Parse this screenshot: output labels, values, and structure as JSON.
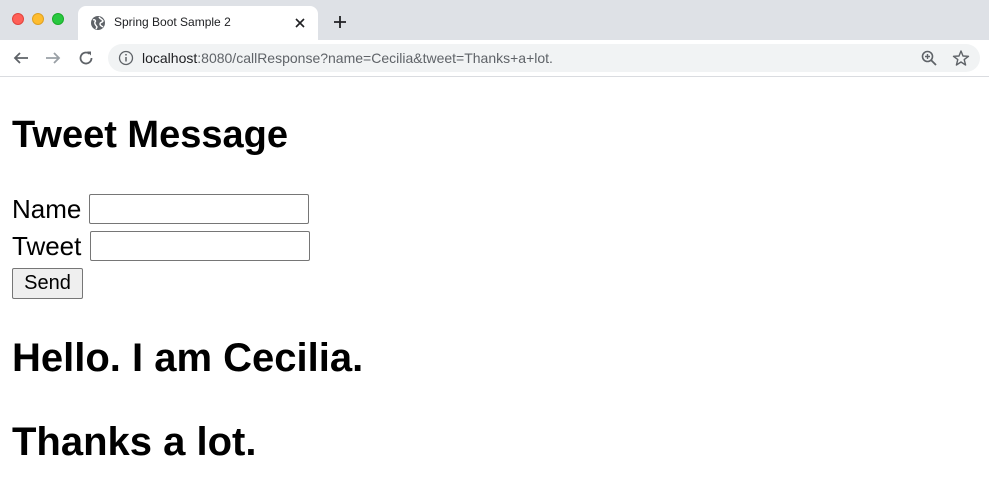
{
  "browser": {
    "tab": {
      "title": "Spring Boot Sample 2",
      "favicon": "globe-icon"
    },
    "url": {
      "host": "localhost",
      "rest": ":8080/callResponse?name=Cecilia&tweet=Thanks+a+lot."
    },
    "icons": {
      "back": "arrow-left-icon",
      "forward": "arrow-right-icon",
      "reload": "reload-icon",
      "info": "info-icon",
      "zoom": "zoom-icon",
      "bookmark": "star-icon",
      "new_tab": "plus-icon",
      "close_tab": "close-icon"
    }
  },
  "page": {
    "title": "Tweet Message",
    "form": {
      "name_label": "Name",
      "name_value": "",
      "tweet_label": "Tweet",
      "tweet_value": "",
      "send_label": "Send"
    },
    "greeting": "Hello. I am Cecilia.",
    "tweet_text": "Thanks a lot."
  }
}
